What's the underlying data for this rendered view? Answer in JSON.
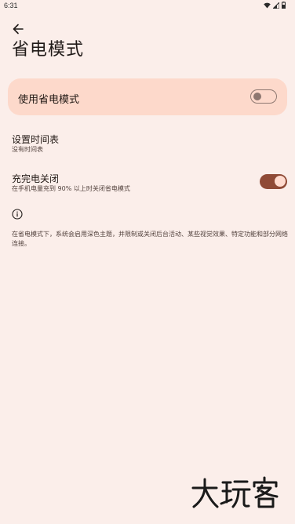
{
  "status_bar": {
    "time": "6:31",
    "icons": [
      "wifi-icon",
      "signal-icon",
      "battery-icon"
    ]
  },
  "header": {
    "back_icon": "arrow-left-icon",
    "title": "省电模式"
  },
  "main_toggle": {
    "label": "使用省电模式",
    "state": "off"
  },
  "settings": {
    "schedule": {
      "title": "设置时间表",
      "subtitle": "没有时间表"
    },
    "turn_off_when_charged": {
      "title": "充完电关闭",
      "subtitle": "在手机电量充到 90% 以上时关闭省电模式",
      "state": "on"
    }
  },
  "footer": {
    "info_icon": "info-icon",
    "text": "在省电模式下，系统会启用深色主题，并限制或关闭后台活动、某些视觉效果、特定功能和部分网络连接。"
  },
  "watermark": {
    "text": "大玩客"
  },
  "colors": {
    "background": "#fbeeea",
    "card": "#fdd9cb",
    "accent": "#8f4a36",
    "knob_on": "#ffdbcf"
  }
}
